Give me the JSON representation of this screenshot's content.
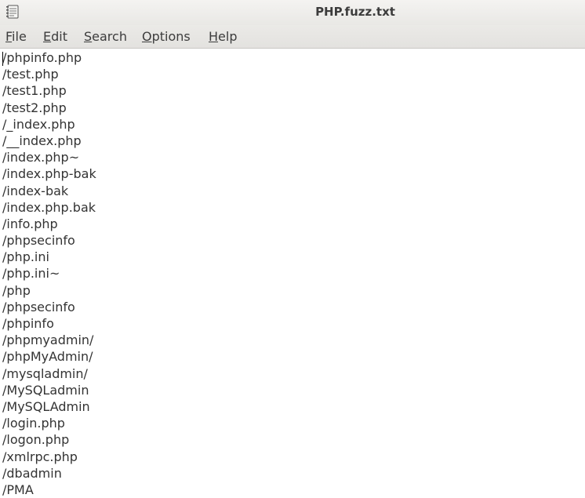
{
  "window": {
    "title": "PHP.fuzz.txt",
    "icon": "text-editor-icon"
  },
  "menu": [
    {
      "label": "File"
    },
    {
      "label": "Edit"
    },
    {
      "label": "Search"
    },
    {
      "label": "Options"
    },
    {
      "label": "Help"
    }
  ],
  "editor": {
    "lines": [
      "/phpinfo.php",
      "/test.php",
      "/test1.php",
      "/test2.php",
      "/_index.php",
      "/__index.php",
      "/index.php~",
      "/index.php-bak",
      "/index-bak",
      "/index.php.bak",
      "/info.php",
      "/phpsecinfo",
      "/php.ini",
      "/php.ini~",
      "/php",
      "/phpsecinfo",
      "/phpinfo",
      "/phpmyadmin/",
      "/phpMyAdmin/",
      "/mysqladmin/",
      "/MySQLadmin",
      "/MySQLAdmin",
      "/login.php",
      "/logon.php",
      "/xmlrpc.php",
      "/dbadmin",
      "/PMA"
    ]
  }
}
